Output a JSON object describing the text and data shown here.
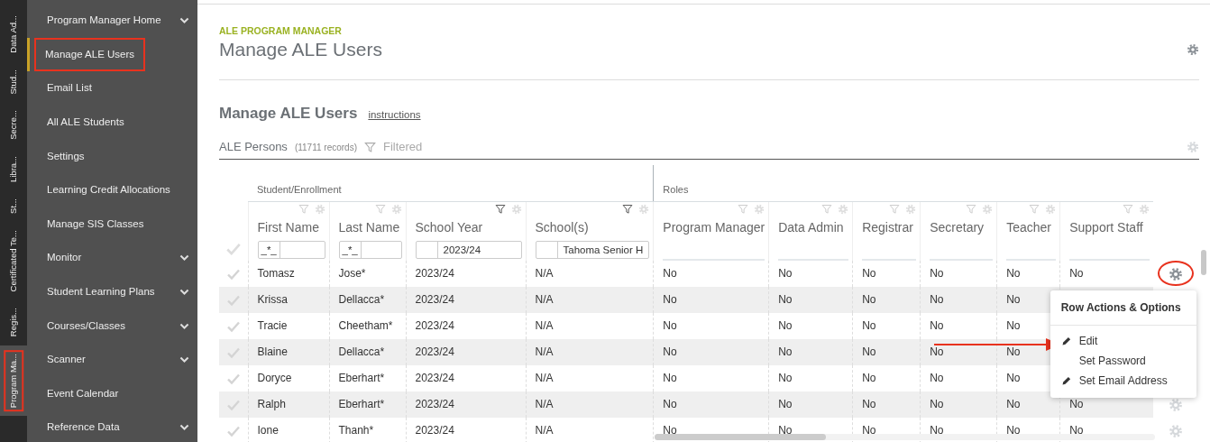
{
  "vertical_tabs": [
    {
      "label": "Data Ad...",
      "selected": false,
      "annotated": false
    },
    {
      "label": "Stud...",
      "selected": false,
      "annotated": false
    },
    {
      "label": "Secre...",
      "selected": false,
      "annotated": false
    },
    {
      "label": "Libra...",
      "selected": false,
      "annotated": false
    },
    {
      "label": "St...",
      "selected": false,
      "annotated": false
    },
    {
      "label": "Certificated Te...",
      "selected": false,
      "annotated": false
    },
    {
      "label": "Regis...",
      "selected": false,
      "annotated": false
    },
    {
      "label": "Program Ma...",
      "selected": true,
      "annotated": true
    }
  ],
  "sidebar": {
    "items": [
      {
        "label": "Program Manager Home",
        "selected": false,
        "expandable": true,
        "annotated": false
      },
      {
        "label": "Manage ALE Users",
        "selected": true,
        "expandable": false,
        "annotated": true
      },
      {
        "label": "Email List",
        "selected": false,
        "expandable": false,
        "annotated": false
      },
      {
        "label": "All ALE Students",
        "selected": false,
        "expandable": false,
        "annotated": false
      },
      {
        "label": "Settings",
        "selected": false,
        "expandable": false,
        "annotated": false
      },
      {
        "label": "Learning Credit Allocations",
        "selected": false,
        "expandable": false,
        "annotated": false
      },
      {
        "label": "Manage SIS Classes",
        "selected": false,
        "expandable": false,
        "annotated": false
      },
      {
        "label": "Monitor",
        "selected": false,
        "expandable": true,
        "annotated": false
      },
      {
        "label": "Student Learning Plans",
        "selected": false,
        "expandable": true,
        "annotated": false
      },
      {
        "label": "Courses/Classes",
        "selected": false,
        "expandable": true,
        "annotated": false
      },
      {
        "label": "Scanner",
        "selected": false,
        "expandable": true,
        "annotated": false
      },
      {
        "label": "Event Calendar",
        "selected": false,
        "expandable": false,
        "annotated": false
      },
      {
        "label": "Reference Data",
        "selected": false,
        "expandable": true,
        "annotated": false
      }
    ]
  },
  "header": {
    "eyebrow": "ALE PROGRAM MANAGER",
    "title": "Manage ALE Users"
  },
  "section": {
    "title": "Manage ALE Users",
    "link": "instructions"
  },
  "grid": {
    "title": "ALE Persons",
    "count": "(11711 records)",
    "filter_label": "Filtered",
    "groups": [
      {
        "label": "Student/Enrollment"
      },
      {
        "label": "Roles"
      }
    ],
    "columns": [
      {
        "label": "First Name",
        "filter_active": false,
        "filter": {
          "operator": "_*_"
        }
      },
      {
        "label": "Last Name",
        "filter_active": false,
        "filter": {
          "operator": "_*_"
        }
      },
      {
        "label": "School Year",
        "filter_active": true,
        "filter": {
          "value": "2023/24"
        }
      },
      {
        "label": "School(s)",
        "filter_active": true,
        "filter": {
          "value": "Tahoma Senior H"
        }
      },
      {
        "label": "Program Manager",
        "filter_active": false
      },
      {
        "label": "Data Admin",
        "filter_active": false
      },
      {
        "label": "Registrar",
        "filter_active": false
      },
      {
        "label": "Secretary",
        "filter_active": false
      },
      {
        "label": "Teacher",
        "filter_active": false
      },
      {
        "label": "Support Staff",
        "filter_active": false
      }
    ],
    "rows": [
      {
        "cells": [
          "Tomasz",
          "Jose*",
          "2023/24",
          "N/A",
          "No",
          "No",
          "No",
          "No",
          "No",
          "No"
        ],
        "menu_open": true
      },
      {
        "cells": [
          "Krissa",
          "Dellacca*",
          "2023/24",
          "N/A",
          "No",
          "No",
          "No",
          "No",
          "No"
        ],
        "menu_open": false
      },
      {
        "cells": [
          "Tracie",
          "Cheetham*",
          "2023/24",
          "N/A",
          "No",
          "No",
          "No",
          "No",
          "No"
        ],
        "menu_open": false
      },
      {
        "cells": [
          "Blaine",
          "Dellacca*",
          "2023/24",
          "N/A",
          "No",
          "No",
          "No",
          "No",
          "No"
        ],
        "menu_open": false
      },
      {
        "cells": [
          "Doryce",
          "Eberhart*",
          "2023/24",
          "N/A",
          "No",
          "No",
          "No",
          "No",
          "No"
        ],
        "menu_open": false
      },
      {
        "cells": [
          "Ralph",
          "Eberhart*",
          "2023/24",
          "N/A",
          "No",
          "No",
          "No",
          "No",
          "No",
          "No"
        ],
        "menu_open": false
      },
      {
        "cells": [
          "Ione",
          "Thanh*",
          "2023/24",
          "N/A",
          "No",
          "No",
          "No",
          "No",
          "No",
          "No"
        ],
        "menu_open": false
      }
    ]
  },
  "context_menu": {
    "title": "Row Actions & Options",
    "items": [
      {
        "label": "Edit",
        "kind": "icon"
      },
      {
        "label": "Set Password",
        "kind": "text"
      },
      {
        "label": "Set Email Address",
        "kind": "icon"
      }
    ]
  }
}
